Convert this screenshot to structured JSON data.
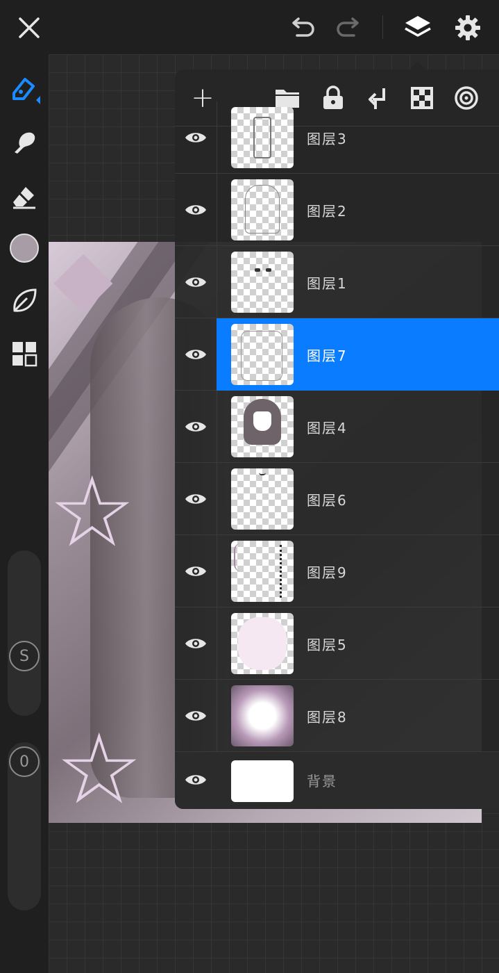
{
  "top_bar": {
    "close_icon": "close-icon",
    "undo_icon": "undo-icon",
    "redo_icon": "redo-icon",
    "layers_icon": "layers-icon",
    "settings_icon": "gear-icon"
  },
  "left_toolbar": {
    "tools": [
      "pen-tool",
      "smudge-tool",
      "eraser-tool",
      "color-swatch",
      "leaf-tool",
      "grid-tool"
    ],
    "current_color": "#a89ca6",
    "size_slider_label": "S",
    "opacity_slider_label": "0"
  },
  "layers_panel": {
    "toolbar_icons": [
      "add-icon",
      "folder-icon",
      "lock-icon",
      "merge-down-icon",
      "checkerboard-icon",
      "target-icon"
    ],
    "add_label": "+",
    "layers": [
      {
        "name": "图层3",
        "visible": true,
        "selected": false
      },
      {
        "name": "图层2",
        "visible": true,
        "selected": false
      },
      {
        "name": "图层1",
        "visible": true,
        "selected": false
      },
      {
        "name": "图层7",
        "visible": true,
        "selected": true
      },
      {
        "name": "图层4",
        "visible": true,
        "selected": false
      },
      {
        "name": "图层6",
        "visible": true,
        "selected": false
      },
      {
        "name": "图层9",
        "visible": true,
        "selected": false
      },
      {
        "name": "图层5",
        "visible": true,
        "selected": false
      },
      {
        "name": "图层8",
        "visible": true,
        "selected": false
      }
    ],
    "background_layer": {
      "name": "背景",
      "visible": true
    },
    "selected_color": "#0a7cff"
  }
}
